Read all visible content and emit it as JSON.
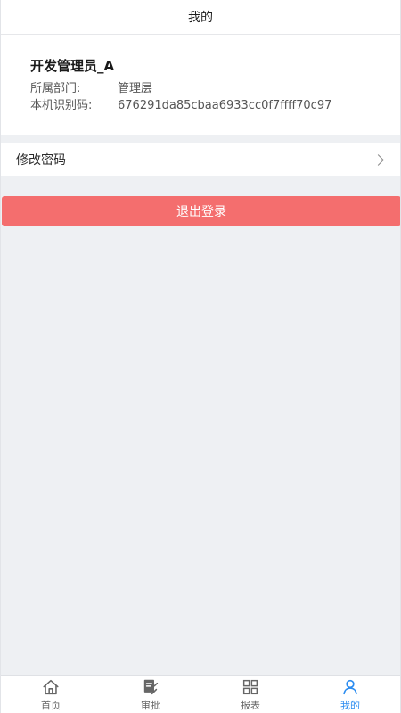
{
  "header": {
    "title": "我的"
  },
  "profile": {
    "name": "开发管理员_A",
    "fields": [
      {
        "label": "所属部门:",
        "value": "管理层"
      },
      {
        "label": "本机识别码:",
        "value": "676291da85cbaa6933cc0f7ffff70c97"
      }
    ]
  },
  "menu": {
    "change_password_label": "修改密码"
  },
  "actions": {
    "logout_label": "退出登录",
    "logout_color": "#f46e6e"
  },
  "tabbar": {
    "active_color": "#2b8cf0",
    "items": [
      {
        "label": "首页",
        "icon": "home-icon",
        "active": false
      },
      {
        "label": "审批",
        "icon": "approval-edit-icon",
        "active": false
      },
      {
        "label": "报表",
        "icon": "grid-report-icon",
        "active": false
      },
      {
        "label": "我的",
        "icon": "user-icon",
        "active": true
      }
    ]
  }
}
